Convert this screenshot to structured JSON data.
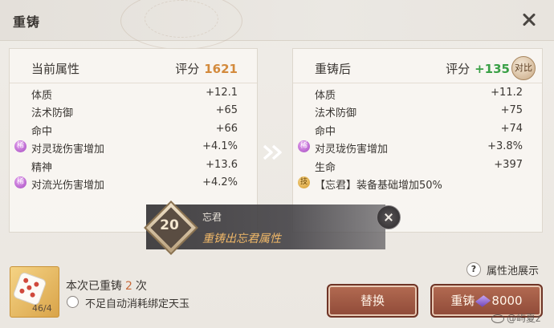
{
  "dialog": {
    "title": "重铸"
  },
  "current": {
    "title": "当前属性",
    "score_label": "评分",
    "score_value": "1621",
    "attrs": [
      {
        "badge": "",
        "name": "体质",
        "value": "+12.1"
      },
      {
        "badge": "",
        "name": "法术防御",
        "value": "+65"
      },
      {
        "badge": "",
        "name": "命中",
        "value": "+66"
      },
      {
        "badge": "purple",
        "badge_text": "稀",
        "name": "对灵珑伤害增加",
        "value": "+4.1%"
      },
      {
        "badge": "",
        "name": "精神",
        "value": "+13.6"
      },
      {
        "badge": "purple",
        "badge_text": "稀",
        "name": "对流光伤害增加",
        "value": "+4.2%"
      }
    ]
  },
  "after": {
    "title": "重铸后",
    "score_label": "评分",
    "score_value": "+135",
    "compare_label": "对比",
    "attrs": [
      {
        "badge": "",
        "name": "体质",
        "value": "+11.2"
      },
      {
        "badge": "",
        "name": "法术防御",
        "value": "+75"
      },
      {
        "badge": "",
        "name": "命中",
        "value": "+74"
      },
      {
        "badge": "purple",
        "badge_text": "稀",
        "name": "对灵珑伤害增加",
        "value": "+3.8%"
      },
      {
        "badge": "",
        "name": "生命",
        "value": "+397"
      },
      {
        "badge": "gold",
        "badge_text": "技",
        "name": "【忘君】装备基础增加50%",
        "value": ""
      }
    ]
  },
  "banner": {
    "level": "20",
    "name": "忘君",
    "desc": "重铸出忘君属性"
  },
  "footer": {
    "dice_count": "46/4",
    "recast_prefix": "本次已重铸",
    "recast_count": "2",
    "recast_suffix": "次",
    "auto_label": "不足自动消耗绑定天玉",
    "pool_label": "属性池展示",
    "help_glyph": "?",
    "replace_label": "替换",
    "recast_label": "重铸",
    "recast_cost": "8000",
    "watermark": "@屿夏z"
  },
  "colors": {
    "score_current": "#d38a3c",
    "score_after": "#3aa046",
    "button": "#9c5540",
    "rare_badge": "#a54bc0",
    "skill_badge": "#d49a2c"
  },
  "icons": [
    "close-icon",
    "compare-icon",
    "arrow-icon",
    "rare-badge-icon",
    "skill-badge-icon",
    "dice-icon",
    "help-icon",
    "gem-icon"
  ]
}
